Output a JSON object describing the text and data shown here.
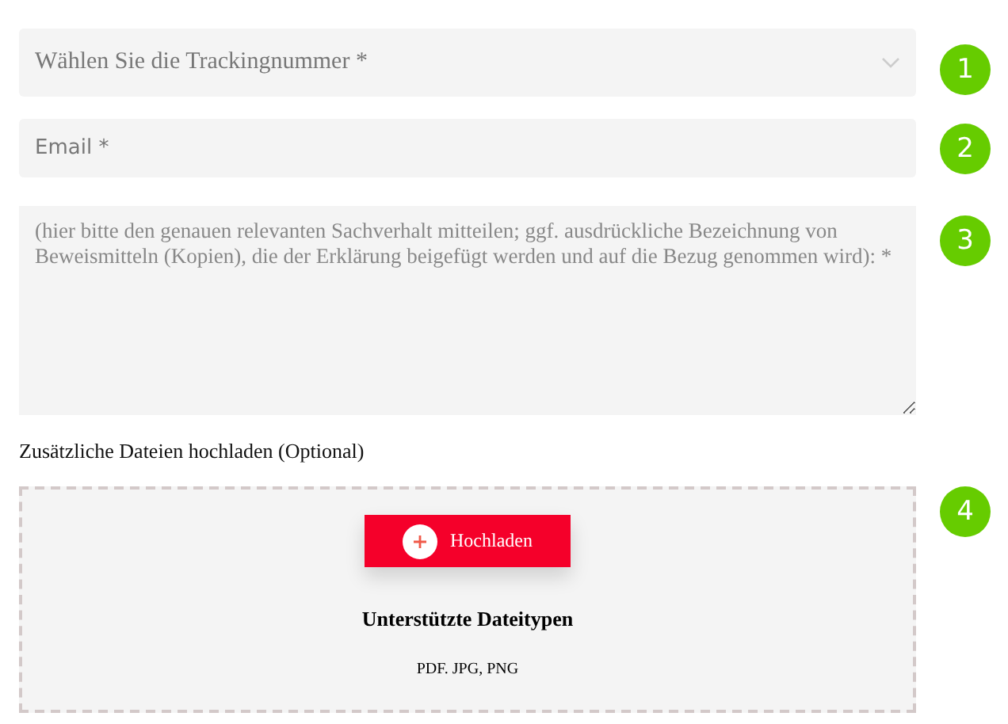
{
  "select": {
    "placeholder": "Wählen Sie die Trackingnummer *",
    "badge": "1"
  },
  "email": {
    "placeholder": "Email *",
    "badge": "2"
  },
  "message": {
    "placeholder": "(hier bitte den genauen relevanten Sachverhalt mitteilen; ggf. ausdrückliche Bezeichnung von Beweismitteln (Kopien), die der Erklärung beigefügt werden und auf die Bezug genommen wird): *",
    "badge": "3"
  },
  "upload": {
    "label": "Zusätzliche Dateien hochladen (Optional)",
    "button": "Hochladen",
    "title": "Unterstützte Dateitypen",
    "types": "PDF. JPG, PNG",
    "badge": "4"
  }
}
